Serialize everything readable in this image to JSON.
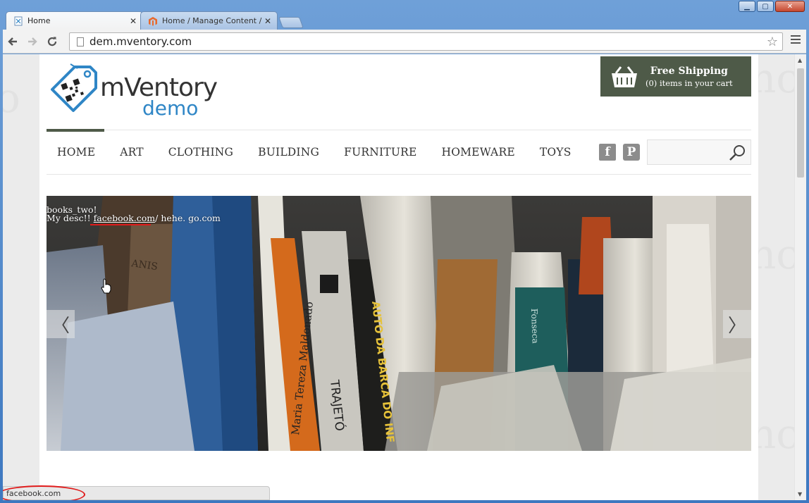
{
  "browser": {
    "tabs": [
      {
        "title": "Home",
        "active": true,
        "close": "✕"
      },
      {
        "title": "Home / Manage Content / Pa",
        "active": false,
        "close": "✕"
      }
    ],
    "window_controls": {
      "minimize": "▁",
      "maximize": "▢",
      "close": "✕"
    },
    "url": "dem.mventory.com",
    "back_icon": "arrow-left-icon",
    "forward_icon": "arrow-right-icon",
    "reload_icon": "reload-icon",
    "bookmark_icon": "star-icon",
    "menu_icon": "hamburger-icon",
    "status_text": "facebook.com"
  },
  "site": {
    "logo": {
      "name": "mVentory",
      "sub": "demo"
    },
    "cart": {
      "title": "Free Shipping",
      "subtitle": "(0) items in your cart"
    },
    "nav": [
      "HOME",
      "ART",
      "CLOTHING",
      "BUILDING",
      "FURNITURE",
      "HOMEWARE",
      "TOYS"
    ],
    "social": {
      "facebook": "f",
      "pinterest": "P"
    },
    "search_placeholder": "",
    "slider": {
      "title": "books_two!",
      "desc_prefix": "My desc!! ",
      "desc_link": "facebook.com",
      "desc_suffix": "/ hehe. go.com",
      "prev": "〈",
      "next": "〉"
    }
  },
  "colors": {
    "accent": "#4e5a48",
    "logo_blue": "#2f86c6",
    "annotation_red": "#e01b1b"
  }
}
